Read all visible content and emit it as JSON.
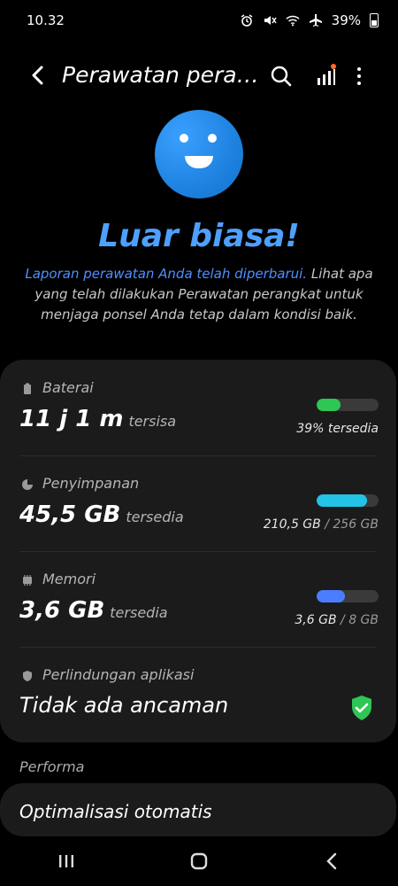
{
  "status": {
    "time": "10.32",
    "battery": "39%"
  },
  "header": {
    "title": "Perawatan pera…"
  },
  "hero": {
    "headline": "Luar biasa!",
    "desc_link": "Laporan perawatan Anda telah diperbarui.",
    "desc_rest": " Lihat apa yang telah dilakukan Perawatan perangkat untuk menjaga ponsel Anda tetap dalam kondisi baik."
  },
  "battery": {
    "label": "Baterai",
    "value": "11 j 1 m",
    "sub": "tersisa",
    "right": "39% tersedia",
    "fill": 0.39,
    "color": "#2ec655"
  },
  "storage": {
    "label": "Penyimpanan",
    "value": "45,5 GB",
    "sub": "tersedia",
    "used": "210,5 GB",
    "sep": " / ",
    "total": "256 GB",
    "fill": 0.82,
    "color": "#22c3e6"
  },
  "memory": {
    "label": "Memori",
    "value": "3,6 GB",
    "sub": "tersedia",
    "used": "3,6 GB",
    "sep": " / ",
    "total": "8 GB",
    "fill": 0.45,
    "color": "#4a7dff"
  },
  "protection": {
    "label": "Perlindungan aplikasi",
    "value": "Tidak ada ancaman",
    "color": "#2ec655"
  },
  "performance": {
    "section": "Performa",
    "auto_opt": "Optimalisasi otomatis"
  }
}
